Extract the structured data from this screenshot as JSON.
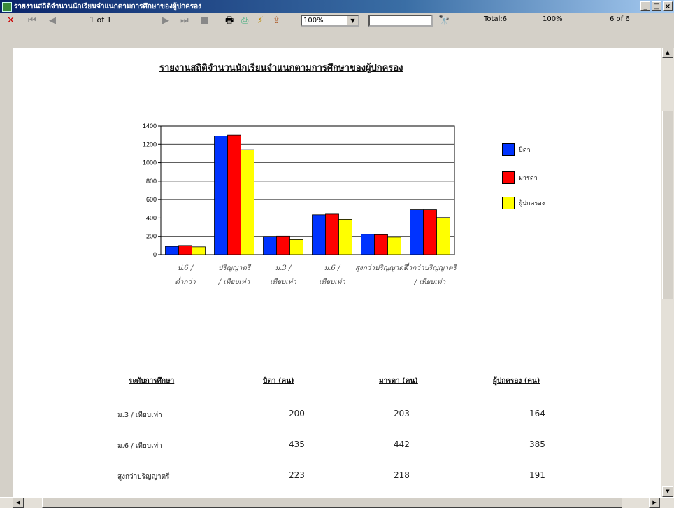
{
  "window": {
    "title": "รายงานสถิติจำนวนนักเรียนจำแนกตามการศึกษาของผู้ปกครอง",
    "controls": [
      "_",
      "□",
      "×"
    ]
  },
  "toolbar": {
    "page_indicator": "1 of 1",
    "zoom_value": "100%",
    "search_value": "",
    "total": "Total:6",
    "percent": "100%",
    "count": "6 of 6"
  },
  "report": {
    "title": "รายงานสถิติจำนวนนักเรียนจำแนกตามการศึกษาของผู้ปกครอง",
    "legend": [
      {
        "label": "บิดา",
        "color": "#0033ff"
      },
      {
        "label": "มารดา",
        "color": "#ff0000"
      },
      {
        "label": "ผู้ปกครอง",
        "color": "#ffff00"
      }
    ],
    "table": {
      "headers": [
        "ระดับการศึกษา",
        "บิดา (คน)",
        "มารดา (คน)",
        "ผู้ปกครอง (คน)"
      ],
      "rows": [
        [
          "ม.3 / เทียบเท่า",
          "200",
          "203",
          "164"
        ],
        [
          "ม.6 / เทียบเท่า",
          "435",
          "442",
          "385"
        ],
        [
          "สูงกว่าปริญญาตรี",
          "223",
          "218",
          "191"
        ]
      ]
    }
  },
  "chart_data": {
    "type": "bar",
    "categories": [
      "ป.6 / ต่ำกว่า",
      "ปริญญาตรี / เทียบเท่า",
      "ม.3 / เทียบเท่า",
      "ม.6 / เทียบเท่า",
      "สูงกว่าปริญญาตรี",
      "ต่ำกว่าปริญญาตรี / เทียบเท่า"
    ],
    "category_lines": [
      [
        "ป.6 /",
        "ต่ำกว่า"
      ],
      [
        "ปริญญาตรี",
        "/ เทียบเท่า"
      ],
      [
        "ม.3 /",
        "เทียบเท่า"
      ],
      [
        "ม.6 /",
        "เทียบเท่า"
      ],
      [
        "สูงกว่าปริญญาตรี",
        ""
      ],
      [
        "ต่ำกว่าปริญญาตรี",
        "/ เทียบเท่า"
      ]
    ],
    "series": [
      {
        "name": "บิดา",
        "color": "#0033ff",
        "values": [
          90,
          1290,
          200,
          435,
          223,
          490
        ]
      },
      {
        "name": "มารดา",
        "color": "#ff0000",
        "values": [
          100,
          1300,
          203,
          442,
          218,
          490
        ]
      },
      {
        "name": "ผู้ปกครอง",
        "color": "#ffff00",
        "values": [
          85,
          1140,
          164,
          385,
          191,
          405
        ]
      }
    ],
    "ylim": [
      0,
      1400
    ],
    "yticks": [
      0,
      200,
      400,
      600,
      800,
      1000,
      1200,
      1400
    ],
    "grid": true,
    "legend_position": "right"
  }
}
